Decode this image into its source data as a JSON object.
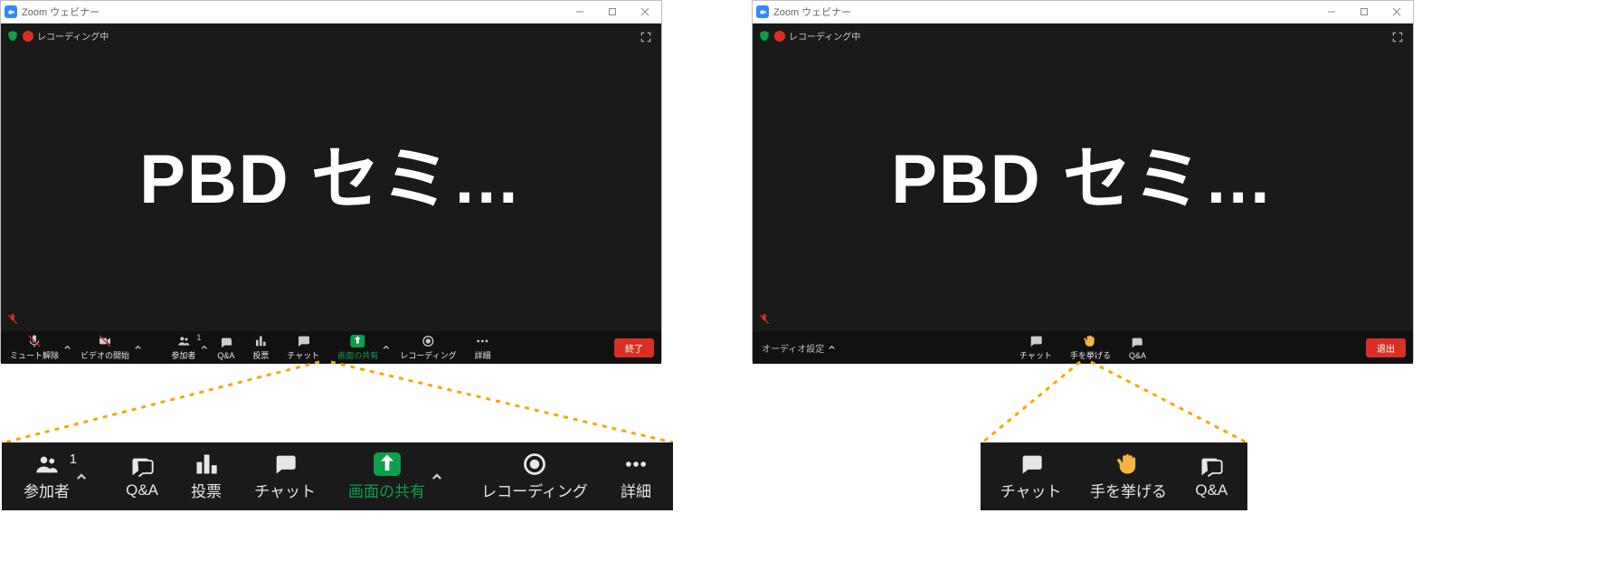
{
  "app": {
    "window_title": "Zoom ウェビナー"
  },
  "recording": {
    "label": "レコーディング中"
  },
  "main": {
    "speaker_label": "PBD セミ…"
  },
  "host_toolbar": {
    "unmute": {
      "label": "ミュート解除"
    },
    "video": {
      "label": "ビデオの開始"
    },
    "participants": {
      "label": "参加者",
      "count": "1"
    },
    "qa": {
      "label": "Q&A"
    },
    "poll": {
      "label": "投票"
    },
    "chat": {
      "label": "チャット"
    },
    "share": {
      "label": "画面の共有"
    },
    "record": {
      "label": "レコーディング"
    },
    "more": {
      "label": "詳細"
    },
    "end": {
      "label": "終了"
    }
  },
  "attendee_toolbar": {
    "audio_settings": {
      "label": "オーディオ設定"
    },
    "chat": {
      "label": "チャット"
    },
    "raise_hand": {
      "label": "手を挙げる"
    },
    "qa": {
      "label": "Q&A"
    },
    "leave": {
      "label": "退出"
    }
  },
  "callout_host": {
    "participants": {
      "label": "参加者",
      "count": "1"
    },
    "qa": {
      "label": "Q&A"
    },
    "poll": {
      "label": "投票"
    },
    "chat": {
      "label": "チャット"
    },
    "share": {
      "label": "画面の共有"
    },
    "record": {
      "label": "レコーディング"
    },
    "more": {
      "label": "詳細"
    }
  },
  "callout_attendee": {
    "chat": {
      "label": "チャット"
    },
    "raise_hand": {
      "label": "手を挙げる"
    },
    "qa": {
      "label": "Q&A"
    }
  }
}
